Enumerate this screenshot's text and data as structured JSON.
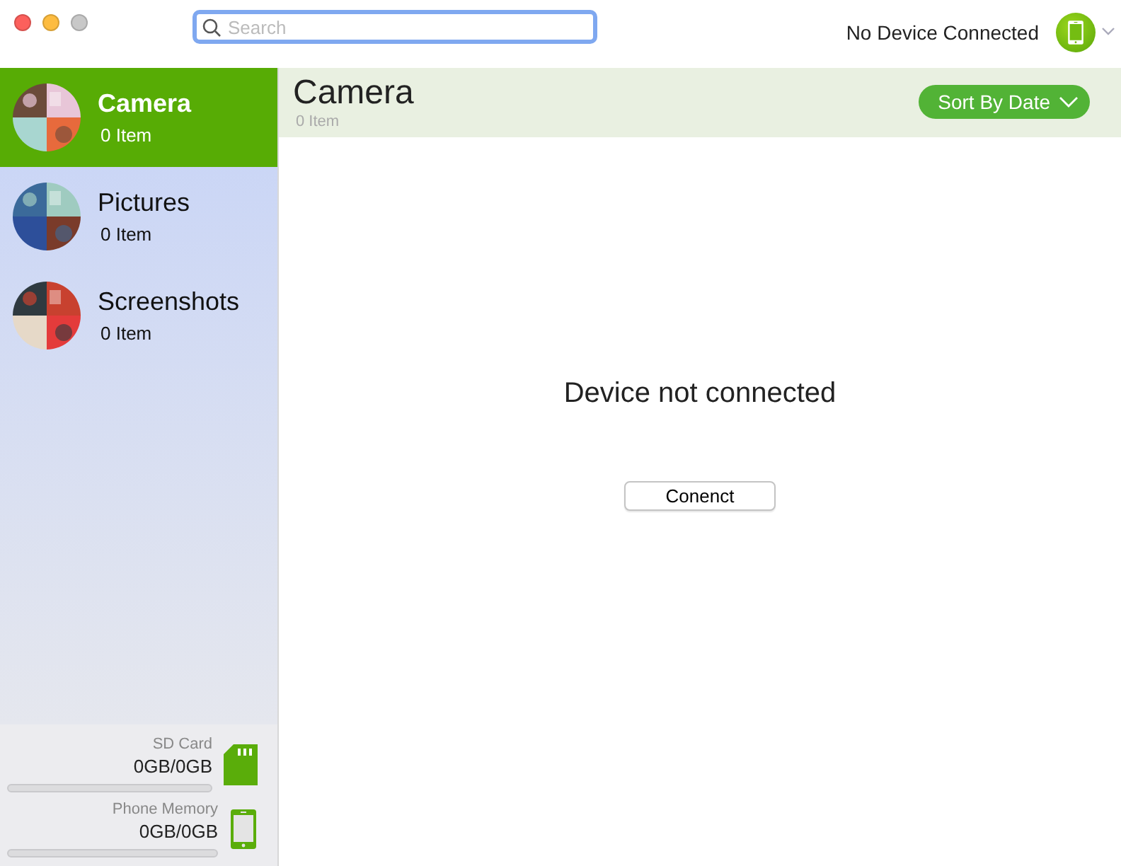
{
  "window": {
    "controls": [
      {
        "kind": "close"
      },
      {
        "kind": "minimize"
      },
      {
        "kind": "zoom"
      }
    ]
  },
  "search": {
    "placeholder": "Search"
  },
  "device": {
    "status": "No Device Connected"
  },
  "sidebar": {
    "items": [
      {
        "label": "Camera",
        "count": "0 Item",
        "selected": true
      },
      {
        "label": "Pictures",
        "count": "0 Item",
        "selected": false
      },
      {
        "label": "Screenshots",
        "count": "0 Item",
        "selected": false
      }
    ]
  },
  "storage": [
    {
      "kind": "sd",
      "label": "SD Card",
      "value": "0GB/0GB",
      "level": 0
    },
    {
      "kind": "phone",
      "label": "Phone Memory",
      "value": "0GB/0GB",
      "level": 0
    }
  ],
  "header": {
    "title": "Camera",
    "count": "0 Item",
    "sort_button": "Sort By Date"
  },
  "content": {
    "message": "Device not connected",
    "button": "Conenct"
  }
}
